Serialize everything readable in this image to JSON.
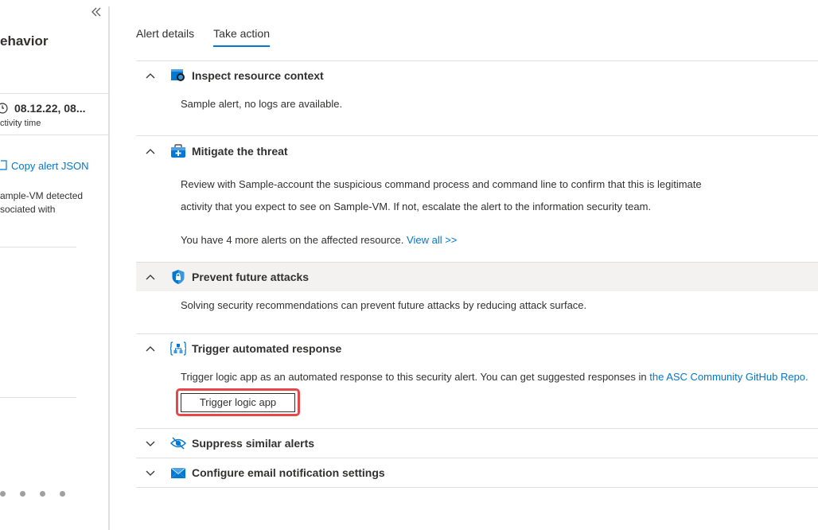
{
  "left_panel": {
    "title": "ehavior",
    "time": "08.12.22, 08...",
    "time_label": "ctivity time",
    "copy_json": "Copy alert JSON",
    "description_line1": "ample-VM detected",
    "description_line2": "sociated with"
  },
  "tabs": [
    {
      "label": "Alert details",
      "active": false
    },
    {
      "label": "Take action",
      "active": true
    }
  ],
  "sections": {
    "inspect": {
      "title": "Inspect resource context",
      "text": "Sample alert, no logs are available.",
      "expanded": true
    },
    "mitigate": {
      "title": "Mitigate the threat",
      "text_line1": "Review with Sample-account the suspicious command process and command line to confirm that this is legitimate",
      "text_line2": "activity that you expect to see on Sample-VM. If not, escalate the alert to the information security team.",
      "more_alerts": "You have 4 more alerts on the affected resource.",
      "view_all": "View all >>",
      "expanded": true
    },
    "prevent": {
      "title": "Prevent future attacks",
      "text": "Solving security recommendations can prevent future attacks by reducing attack surface.",
      "expanded": true
    },
    "trigger": {
      "title": "Trigger automated response",
      "text": "Trigger logic app as an automated response to this security alert. You can get suggested responses in",
      "link": "the ASC Community GitHub Repo.",
      "button": "Trigger logic app",
      "expanded": true
    },
    "suppress": {
      "title": "Suppress similar alerts",
      "expanded": false
    },
    "email": {
      "title": "Configure email notification settings",
      "expanded": false
    }
  },
  "colors": {
    "accent": "#0078d4",
    "highlight_border": "#e8474a",
    "section_hover": "#f3f2f1"
  }
}
